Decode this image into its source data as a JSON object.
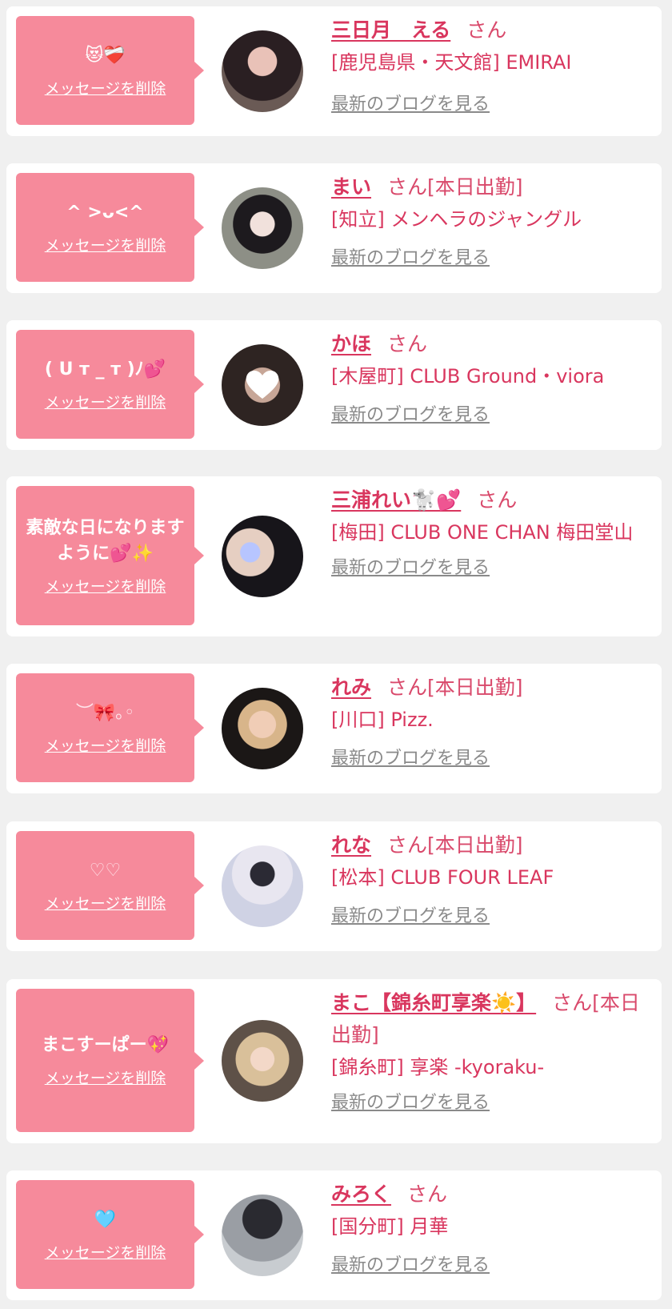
{
  "delete_label": "メッセージを削除",
  "san": "さん",
  "blog_label": "最新のブログを見る",
  "colors": {
    "bubble": "#f68a9b",
    "name": "#d9365e",
    "blog": "#8a8a8a",
    "card": "#ffffff",
    "page": "#f0f0f0"
  },
  "entries": [
    {
      "message": "😻❤️‍🩹",
      "name": "三日月　える",
      "status": "",
      "shop": "[鹿児島県・天文館] EMIRAI",
      "avatar": "avatar-photo"
    },
    {
      "message": "^ >ᴗ<^",
      "name": "まい",
      "status": "[本日出勤]",
      "shop": "[知立] メンヘラのジャングル",
      "avatar": "avatar-photo"
    },
    {
      "message": "( U ᴛ _ ᴛ )ﾉ💕",
      "name": "かほ",
      "status": "",
      "shop": "[木屋町] CLUB Ground・viora",
      "avatar": "avatar-heart"
    },
    {
      "message": "素敵な日になりますように💕✨",
      "name": "三浦れい🐩💕",
      "status": "",
      "shop": "[梅田] CLUB ONE CHAN 梅田堂山",
      "avatar": "avatar-photo"
    },
    {
      "message": "︶🎀｡◦",
      "name": "れみ",
      "status": "[本日出勤]",
      "shop": "[川口] Pizz.",
      "avatar": "avatar-photo"
    },
    {
      "message": "♡♡",
      "name": "れな",
      "status": "[本日出勤]",
      "shop": "[松本] CLUB FOUR LEAF",
      "avatar": "avatar-photo"
    },
    {
      "message": "まこすーぱー💖",
      "name": "まこ【錦糸町享楽☀️】",
      "status": "[本日出勤]",
      "shop": "[錦糸町] 享楽 -kyoraku-",
      "avatar": "avatar-photo"
    },
    {
      "message": "🩵",
      "name": "みろく",
      "status": "",
      "shop": "[国分町] 月華",
      "avatar": "avatar-photo"
    }
  ]
}
